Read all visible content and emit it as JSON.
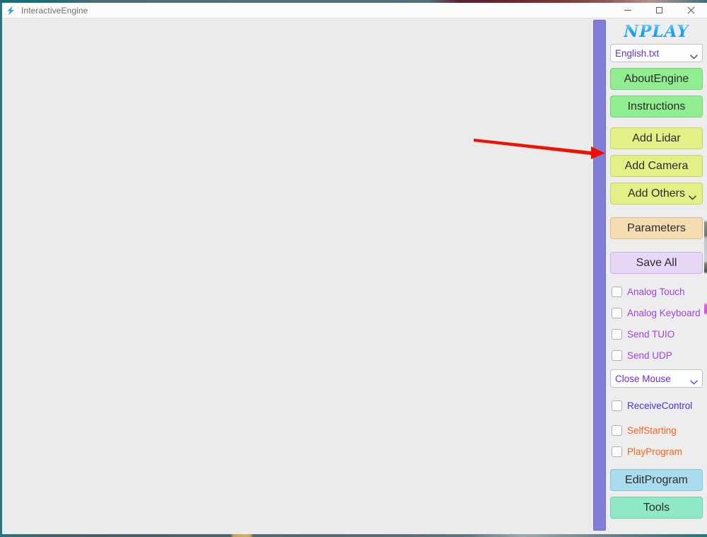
{
  "window": {
    "title": "InteractiveEngine",
    "icon": "lightning-bolt-icon",
    "controls": {
      "minimize": "Minimize",
      "maximize": "Maximize",
      "close": "Close"
    }
  },
  "sidebar": {
    "logo": "NPLAY",
    "language_select": {
      "value": "English.txt",
      "icon": "chevron-down-icon"
    },
    "buttons": [
      {
        "label": "AboutEngine",
        "style": "green",
        "dropdown": false
      },
      {
        "label": "Instructions",
        "style": "green",
        "dropdown": false
      },
      {
        "label": "Add Lidar",
        "style": "yellow",
        "dropdown": false
      },
      {
        "label": "Add Camera",
        "style": "yellow",
        "dropdown": false
      },
      {
        "label": "Add Others",
        "style": "yellow",
        "dropdown": true
      },
      {
        "label": "Parameters",
        "style": "tan",
        "dropdown": false
      },
      {
        "label": "Save All",
        "style": "lavender",
        "dropdown": false
      }
    ],
    "checkboxes_group1": [
      {
        "label": "Analog Touch",
        "checked": false,
        "color": "purple"
      },
      {
        "label": "Analog Keyboard",
        "checked": false,
        "color": "purple"
      },
      {
        "label": "Send TUIO",
        "checked": false,
        "color": "purple"
      },
      {
        "label": "Send UDP",
        "checked": false,
        "color": "purple"
      }
    ],
    "mouse_select": {
      "value": "Close Mouse",
      "icon": "chevron-down-icon"
    },
    "checkboxes_group2": [
      {
        "label": "ReceiveControl",
        "checked": false,
        "color": "indigo"
      },
      {
        "label": "SelfStarting",
        "checked": false,
        "color": "orange"
      },
      {
        "label": "PlayProgram",
        "checked": false,
        "color": "orange"
      }
    ],
    "bottom_buttons": [
      {
        "label": "EditProgram",
        "style": "blue"
      },
      {
        "label": "Tools",
        "style": "aqua"
      }
    ]
  },
  "annotation": {
    "arrow": "red-arrow-pointing-right",
    "color": "#f01000"
  },
  "colors": {
    "accent_teal": "#2a7480",
    "splitter_purple": "#7f7fd5",
    "canvas_bg": "#ebebeb",
    "panel_bg": "#ededed",
    "btn_green": "#90ee90",
    "btn_yellow": "#e3ef87",
    "btn_tan": "#f5dbb0",
    "btn_lavender": "#e6d7f7",
    "btn_blue": "#aadcf0",
    "btn_aqua": "#8fe8c6",
    "label_purple": "#a23fe0",
    "label_indigo": "#4333e8",
    "label_orange": "#f4651a",
    "logo_cyan": "#18a6ef"
  }
}
